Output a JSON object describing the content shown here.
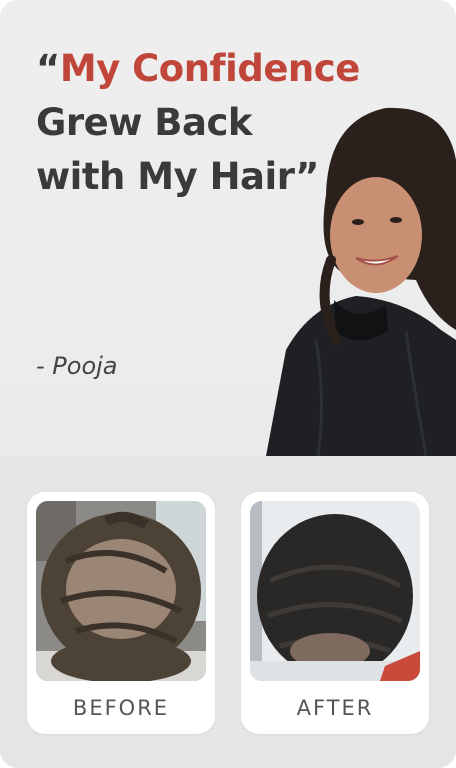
{
  "testimonial": {
    "quote_open": "“",
    "quote_accent": "My Confidence",
    "quote_line2": "Grew Back",
    "quote_line3": "with My Hair”",
    "author": "- Pooja"
  },
  "comparison": {
    "before_label": "BEFORE",
    "after_label": "AFTER"
  },
  "colors": {
    "accent": "#c0463a",
    "text": "#3a3a3a",
    "background": "#e6e6e6"
  }
}
